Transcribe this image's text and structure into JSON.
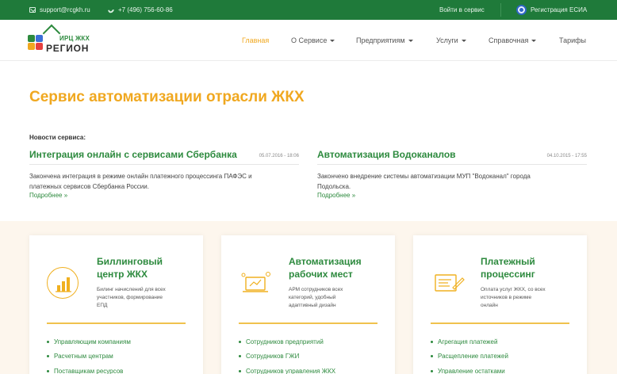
{
  "topbar": {
    "email": "support@rcgkh.ru",
    "phone": "+7 (496) 756-60-86",
    "login": "Войти в сервис",
    "esia": "Регистрация ЕСИА"
  },
  "logo": {
    "small": "ИРЦ ЖКХ",
    "big": "РЕГИОН"
  },
  "nav": {
    "items": [
      {
        "label": "Главная",
        "active": true
      },
      {
        "label": "О Сервисе",
        "dropdown": true
      },
      {
        "label": "Предприятиям",
        "dropdown": true
      },
      {
        "label": "Услуги",
        "dropdown": true
      },
      {
        "label": "Справочная",
        "dropdown": true
      },
      {
        "label": "Тарифы"
      }
    ]
  },
  "hero": {
    "title": "Сервис автоматизации отрасли ЖКХ"
  },
  "news": {
    "label": "Новости сервиса:",
    "more": "Подробнее »",
    "items": [
      {
        "title": "Интеграция онлайн с сервисами Сбербанка",
        "date": "05.07.2016 - 18:06",
        "line1": "Закончена интеграция в режиме онлайн платежного процессинга ПАФЭС и",
        "line2": "платежных сервисов Сбербанка России."
      },
      {
        "title": "Автоматизация Водоканалов",
        "date": "04.10.2015 - 17:55",
        "line1": "Закончено внедрение системы автоматизации МУП \"Водоканал\" города",
        "line2": "Подольска."
      }
    ]
  },
  "cards": [
    {
      "title1": "Биллинговый",
      "title2": "центр ЖКХ",
      "desc1": "Билинг начислений для всех",
      "desc2": "участников, формирование",
      "desc3": "ЕПД",
      "icon": "billing-chart-icon",
      "list": [
        "Управляющим компаниям",
        "Расчетным центрам",
        "Поставщикам ресурсов"
      ]
    },
    {
      "title1": "Автоматизация",
      "title2": "рабочих мест",
      "desc1": "АРМ сотрудников всех",
      "desc2": "категорий, удобный",
      "desc3": "адаптивный дизайн",
      "icon": "workplace-laptop-icon",
      "list": [
        "Сотрудников предприятий",
        "Сотрудников ГЖИ",
        "Сотрудников управления ЖКХ"
      ]
    },
    {
      "title1": "Платежный",
      "title2": "процессинг",
      "desc1": "Оплата услуг ЖКХ, со всех",
      "desc2": "источников в режиме",
      "desc3": "онлайн",
      "icon": "payment-card-icon",
      "list": [
        "Агрегация платежей",
        "Расщепление платежей",
        "Управление остатками"
      ]
    }
  ],
  "colors": {
    "topbar": "#1f7a3a",
    "green": "#2d8a3e",
    "orange": "#f0a820",
    "services_bg": "#fdf6ed"
  }
}
